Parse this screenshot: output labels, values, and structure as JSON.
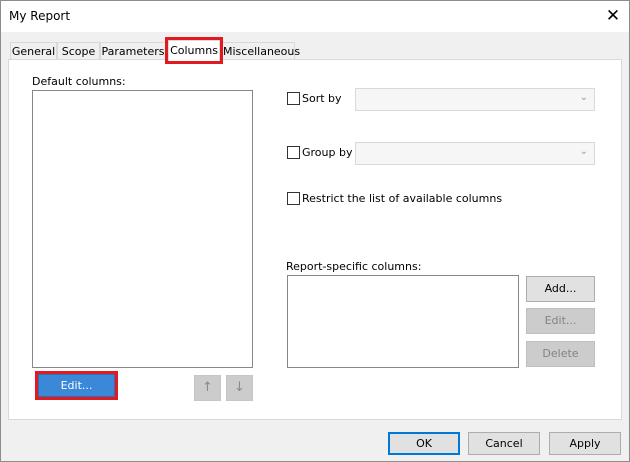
{
  "window": {
    "title": "My Report",
    "close_glyph": "✕"
  },
  "tabs": [
    {
      "label": "General"
    },
    {
      "label": "Scope"
    },
    {
      "label": "Parameters"
    },
    {
      "label": "Columns"
    },
    {
      "label": "Miscellaneous"
    }
  ],
  "active_tab": "Columns",
  "left": {
    "default_columns_label": "Default columns:",
    "edit_button": "Edit...",
    "up_icon": "arrow-up-icon",
    "down_icon": "arrow-down-icon"
  },
  "right": {
    "sort_by_label": "Sort by",
    "sort_by_value": "",
    "group_by_label": "Group by",
    "group_by_value": "",
    "restrict_label": "Restrict the list of available columns",
    "report_specific_label": "Report-specific columns:",
    "add_button": "Add...",
    "edit_button": "Edit...",
    "delete_button": "Delete"
  },
  "footer": {
    "ok": "OK",
    "cancel": "Cancel",
    "apply": "Apply"
  },
  "colors": {
    "highlight": "#e2191f",
    "accent": "#0078d7",
    "primary_button": "#3c88d8"
  }
}
